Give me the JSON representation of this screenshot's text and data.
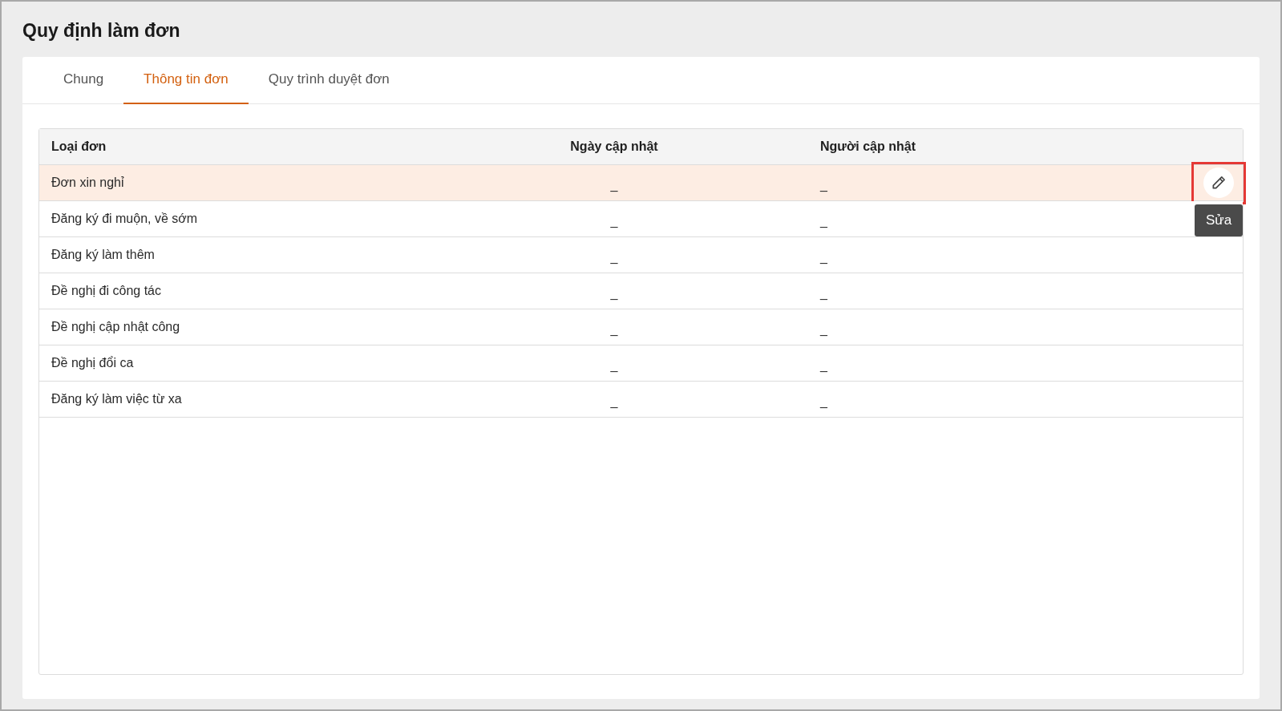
{
  "page_title": "Quy định làm đơn",
  "tabs": [
    {
      "label": "Chung",
      "selected": false
    },
    {
      "label": "Thông tin đơn",
      "selected": true
    },
    {
      "label": "Quy trình duyệt đơn",
      "selected": false
    }
  ],
  "table": {
    "columns": [
      "Loại đơn",
      "Ngày cập nhật",
      "Người cập nhật"
    ],
    "rows": [
      {
        "cells": [
          "Đơn xin nghỉ",
          "_",
          "_"
        ],
        "selected": true
      },
      {
        "cells": [
          "Đăng ký đi muộn, về sớm",
          "_",
          "_"
        ],
        "selected": false
      },
      {
        "cells": [
          "Đăng ký làm thêm",
          "_",
          "_"
        ],
        "selected": false
      },
      {
        "cells": [
          "Đề nghị đi công tác",
          "_",
          "_"
        ],
        "selected": false
      },
      {
        "cells": [
          "Đề nghị cập nhật công",
          "_",
          "_"
        ],
        "selected": false
      },
      {
        "cells": [
          "Đề nghị đổi ca",
          "_",
          "_"
        ],
        "selected": false
      },
      {
        "cells": [
          "Đăng ký làm việc từ xa",
          "_",
          "_"
        ],
        "selected": false
      }
    ]
  },
  "tooltip": "Sửa"
}
